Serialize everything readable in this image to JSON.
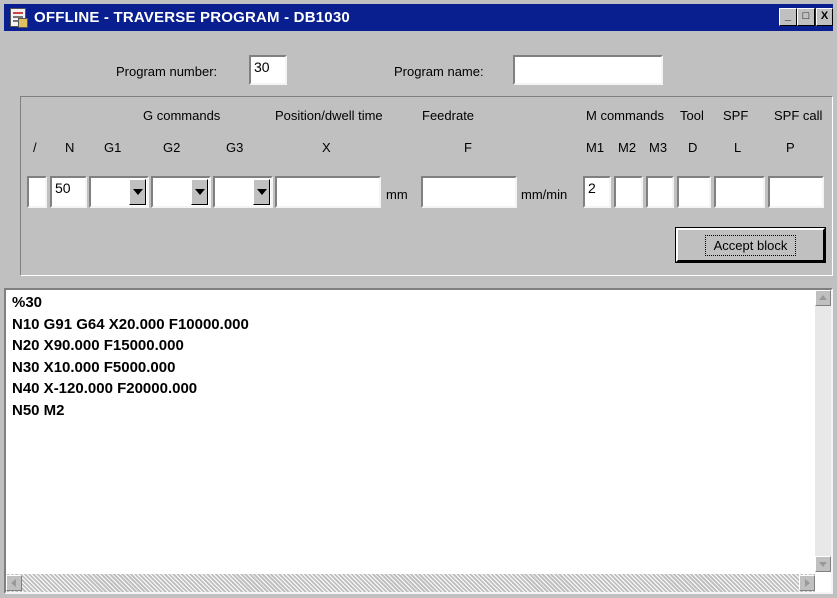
{
  "window": {
    "title": "OFFLINE - TRAVERSE PROGRAM - DB1030",
    "min_glyph": "_",
    "max_glyph": "□",
    "close_glyph": "X"
  },
  "program": {
    "number_label": "Program number:",
    "number_value": "30",
    "name_label": "Program name:",
    "name_value": ""
  },
  "block": {
    "headers": {
      "g_commands": "G commands",
      "position": "Position/dwell time",
      "feedrate": "Feedrate",
      "m_commands": "M commands",
      "tool": "Tool",
      "spf": "SPF",
      "spf_call": "SPF call"
    },
    "columns": {
      "skip": "/",
      "n": "N",
      "g1": "G1",
      "g2": "G2",
      "g3": "G3",
      "x": "X",
      "f": "F",
      "m1": "M1",
      "m2": "M2",
      "m3": "M3",
      "d": "D",
      "l": "L",
      "p": "P"
    },
    "values": {
      "skip": "",
      "n": "50",
      "g1": "",
      "g2": "",
      "g3": "",
      "x": "",
      "f": "",
      "m1": "2",
      "m2": "",
      "m3": "",
      "d": "",
      "l": "",
      "p": ""
    },
    "units": {
      "x": "mm",
      "f": "mm/min"
    },
    "accept_label": "Accept block"
  },
  "listing": {
    "lines": [
      "%30",
      "N10 G91 G64 X20.000 F10000.000",
      "N20 X90.000 F15000.000",
      "N30 X10.000 F5000.000",
      "N40 X-120.000 F20000.000",
      "N50 M2"
    ]
  },
  "colors": {
    "titlebar": "#0a1f8f",
    "face": "#c0c0c0"
  }
}
